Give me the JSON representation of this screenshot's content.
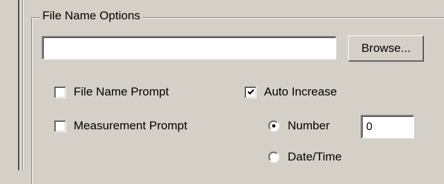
{
  "group": {
    "title": "File Name Options"
  },
  "file_name_field": {
    "value": "",
    "placeholder": ""
  },
  "browse_button": {
    "label": "Browse..."
  },
  "checkboxes": {
    "file_name_prompt": {
      "label": "File Name Prompt",
      "checked": false
    },
    "measurement_prompt": {
      "label": "Measurement Prompt",
      "checked": false
    },
    "auto_increase": {
      "label": "Auto Increase",
      "checked": true
    }
  },
  "increment_mode": {
    "selected": "number",
    "options": [
      {
        "id": "number",
        "label": "Number"
      },
      {
        "id": "datetime",
        "label": "Date/Time"
      }
    ]
  },
  "number_field": {
    "value": "0"
  },
  "colors": {
    "face": "#d4d0c8",
    "shadow": "#808080",
    "dark_shadow": "#404040",
    "highlight": "#ffffff",
    "field_bg": "#ffffff"
  }
}
